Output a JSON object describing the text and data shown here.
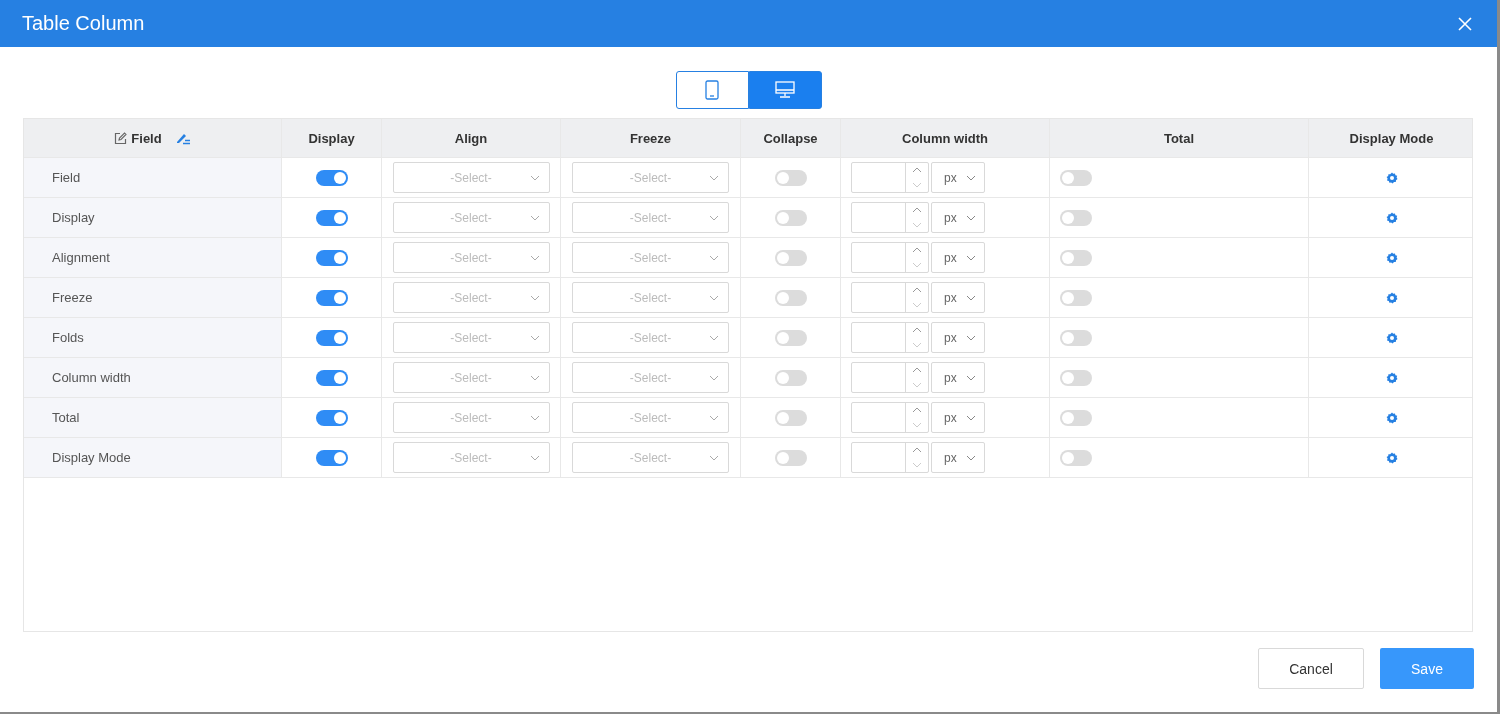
{
  "window": {
    "title": "Table Column"
  },
  "view_toggle": [
    {
      "kind": "mobile",
      "selected": false
    },
    {
      "kind": "desktop",
      "selected": true
    }
  ],
  "columns": [
    "Field",
    "Display",
    "Align",
    "Freeze",
    "Collapse",
    "Column width",
    "Total",
    "Display Mode"
  ],
  "rows": [
    {
      "field": "Field",
      "display": true,
      "align": {
        "placeholder": "-Select-"
      },
      "freeze": {
        "placeholder": "-Select-"
      },
      "collapse": false,
      "unit": "px",
      "total": false
    },
    {
      "field": "Display",
      "display": true,
      "align": {
        "placeholder": "-Select-"
      },
      "freeze": {
        "placeholder": "-Select-"
      },
      "collapse": false,
      "unit": "px",
      "total": false
    },
    {
      "field": "Alignment",
      "display": true,
      "align": {
        "placeholder": "-Select-"
      },
      "freeze": {
        "placeholder": "-Select-"
      },
      "collapse": false,
      "unit": "px",
      "total": false
    },
    {
      "field": "Freeze",
      "display": true,
      "align": {
        "placeholder": "-Select-"
      },
      "freeze": {
        "placeholder": "-Select-"
      },
      "collapse": false,
      "unit": "px",
      "total": false
    },
    {
      "field": "Folds",
      "display": true,
      "align": {
        "placeholder": "-Select-"
      },
      "freeze": {
        "placeholder": "-Select-"
      },
      "collapse": false,
      "unit": "px",
      "total": false
    },
    {
      "field": "Column width",
      "display": true,
      "align": {
        "placeholder": "-Select-"
      },
      "freeze": {
        "placeholder": "-Select-"
      },
      "collapse": false,
      "unit": "px",
      "total": false
    },
    {
      "field": "Total",
      "display": true,
      "align": {
        "placeholder": "-Select-"
      },
      "freeze": {
        "placeholder": "-Select-"
      },
      "collapse": false,
      "unit": "px",
      "total": false
    },
    {
      "field": "Display Mode",
      "display": true,
      "align": {
        "placeholder": "-Select-"
      },
      "freeze": {
        "placeholder": "-Select-"
      },
      "collapse": false,
      "unit": "px",
      "total": false
    }
  ],
  "buttons": [
    {
      "kind": "secondary",
      "label": "Cancel"
    },
    {
      "kind": "primary",
      "label": "Save"
    }
  ]
}
